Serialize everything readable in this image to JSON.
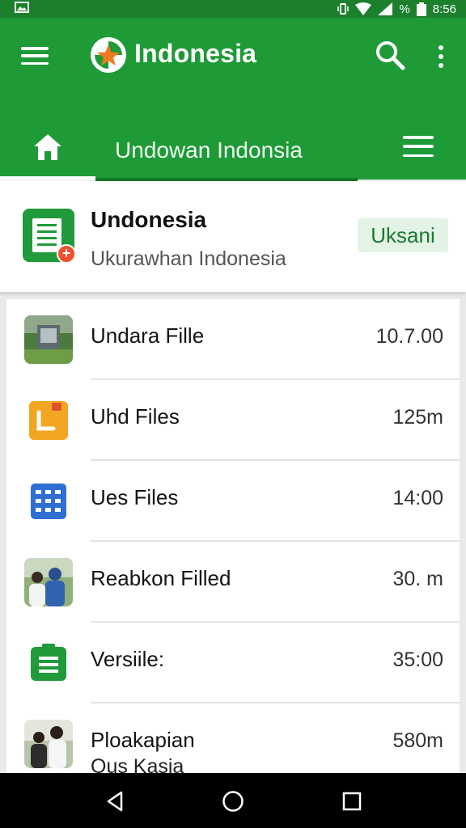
{
  "status_bar": {
    "percent_label": "%",
    "time": "8:56"
  },
  "app_bar": {
    "title": "Indonesia"
  },
  "tabs": {
    "active_label": "Undowan Indonsia"
  },
  "header_card": {
    "title": "Undonesia",
    "subtitle": "Ukurawhan Indonesia",
    "badge": "Uksani"
  },
  "files": [
    {
      "name": "Undara Fille",
      "value": "10.7.00",
      "icon": "photo-thumbnail-icon"
    },
    {
      "name": "Uhd Files",
      "value": "125m",
      "icon": "orange-folder-icon"
    },
    {
      "name": "Ues Files",
      "value": "14:00",
      "icon": "blue-grid-icon"
    },
    {
      "name": "Reabkon Filled",
      "value": "30. m",
      "icon": "people-photo-icon"
    },
    {
      "name": "Versiile:",
      "value": "35:00",
      "icon": "green-document-icon"
    },
    {
      "name": "Ploakapian",
      "sub": "Ous Kasia",
      "value": "580m",
      "icon": "people-photo-icon"
    }
  ],
  "colors": {
    "primary": "#1e9a37",
    "primary_dark": "#1b7f2c",
    "accent": "#f0502e",
    "badge_bg": "#e3f4e6"
  }
}
